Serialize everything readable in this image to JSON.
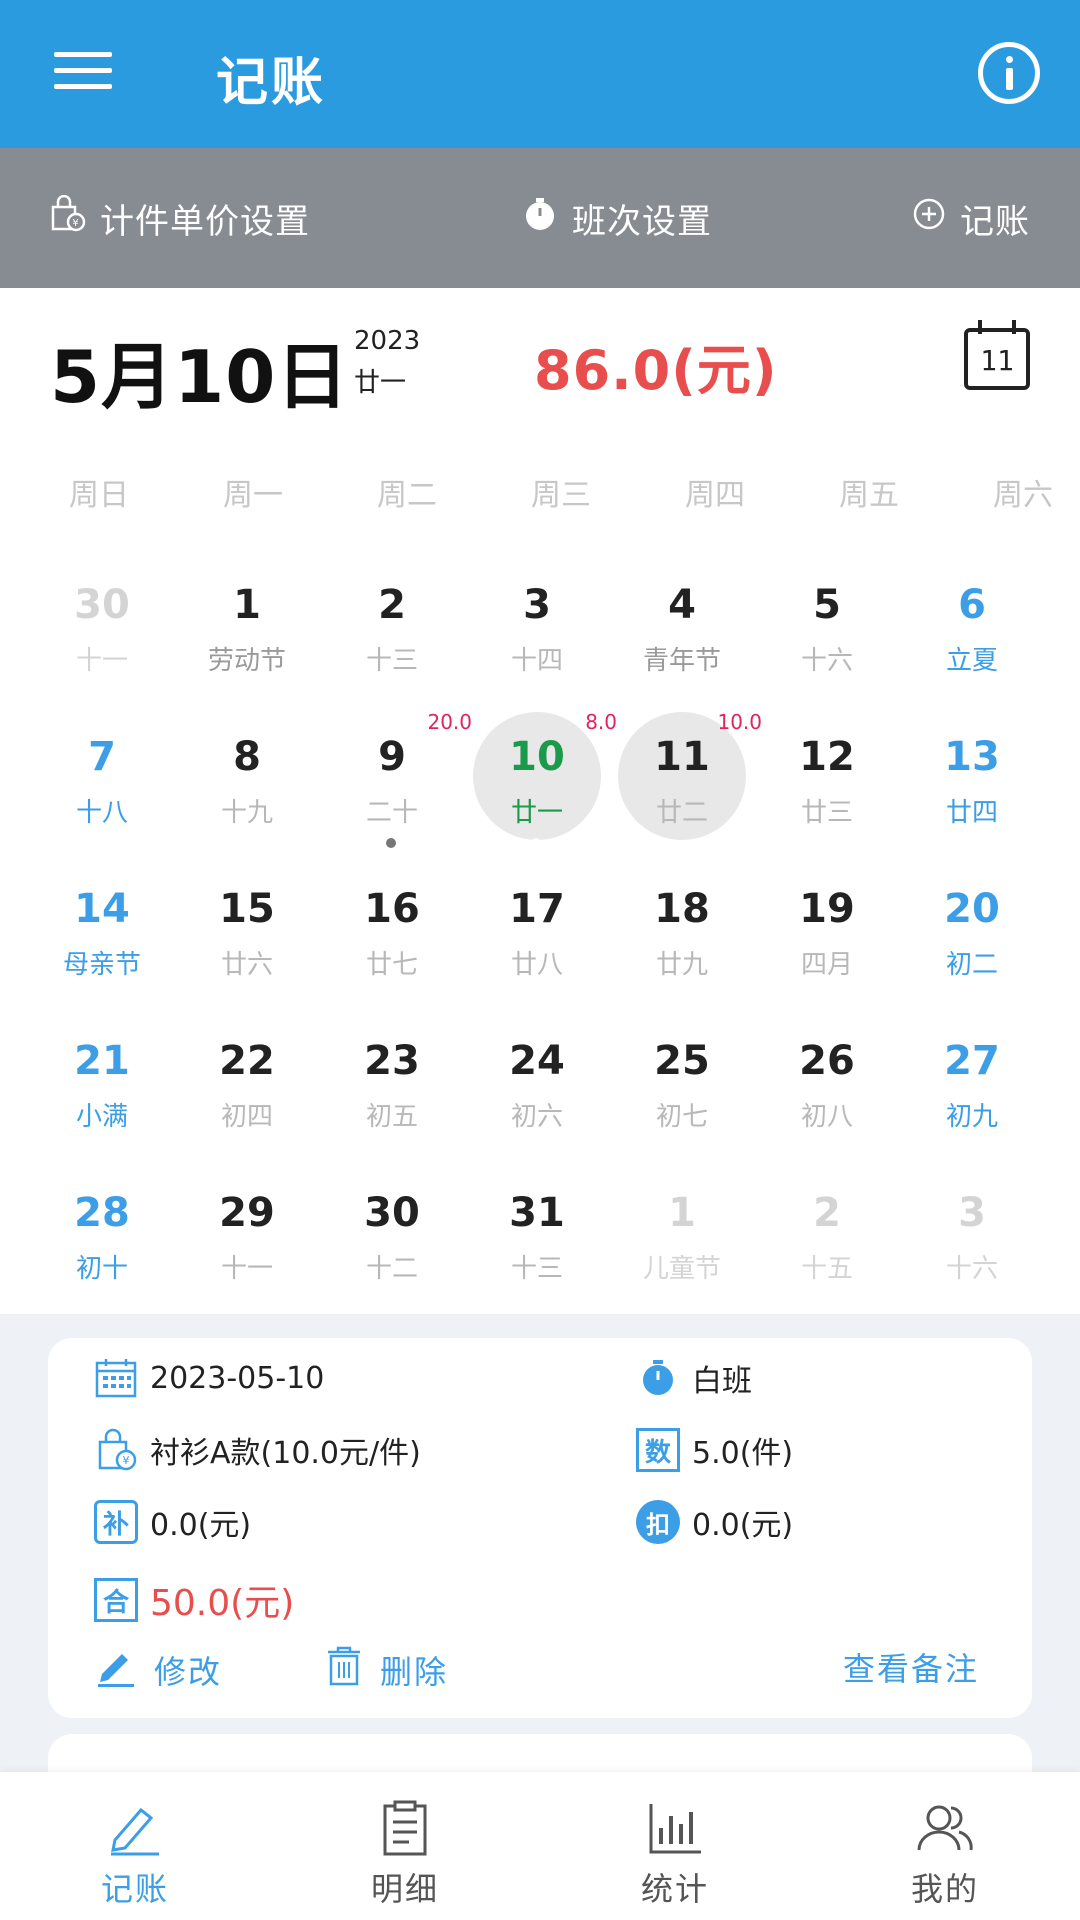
{
  "app": {
    "title": "记账"
  },
  "toolbar": {
    "price_setting": "计件单价设置",
    "shift_setting": "班次设置",
    "add_record": "记账"
  },
  "header": {
    "date": "5月10日",
    "year": "2023",
    "lunar": "廿一",
    "day_total": "86.0(元)",
    "calendar_icon_day": "11"
  },
  "weekdays": [
    "周日",
    "周一",
    "周二",
    "周三",
    "周四",
    "周五",
    "周六"
  ],
  "calendar": {
    "weeks": [
      [
        {
          "num": "30",
          "lunar": "十一",
          "type": "other"
        },
        {
          "num": "1",
          "lunar": "劳动节",
          "type": "holiday"
        },
        {
          "num": "2",
          "lunar": "十三",
          "type": ""
        },
        {
          "num": "3",
          "lunar": "十四",
          "type": ""
        },
        {
          "num": "4",
          "lunar": "青年节",
          "type": "holiday"
        },
        {
          "num": "5",
          "lunar": "十六",
          "type": ""
        },
        {
          "num": "6",
          "lunar": "立夏",
          "type": "weekend"
        }
      ],
      [
        {
          "num": "7",
          "lunar": "十八",
          "type": "weekend"
        },
        {
          "num": "8",
          "lunar": "十九",
          "type": ""
        },
        {
          "num": "9",
          "lunar": "二十",
          "type": "",
          "amount": "20.0",
          "mark": true
        },
        {
          "num": "10",
          "lunar": "廿一",
          "type": "today",
          "amount": "8.0",
          "mark": true,
          "selected": true
        },
        {
          "num": "11",
          "lunar": "廿二",
          "type": "",
          "amount": "10.0",
          "selected": true
        },
        {
          "num": "12",
          "lunar": "廿三",
          "type": ""
        },
        {
          "num": "13",
          "lunar": "廿四",
          "type": "weekend"
        }
      ],
      [
        {
          "num": "14",
          "lunar": "母亲节",
          "type": "weekend"
        },
        {
          "num": "15",
          "lunar": "廿六",
          "type": ""
        },
        {
          "num": "16",
          "lunar": "廿七",
          "type": ""
        },
        {
          "num": "17",
          "lunar": "廿八",
          "type": ""
        },
        {
          "num": "18",
          "lunar": "廿九",
          "type": ""
        },
        {
          "num": "19",
          "lunar": "四月",
          "type": ""
        },
        {
          "num": "20",
          "lunar": "初二",
          "type": "weekend"
        }
      ],
      [
        {
          "num": "21",
          "lunar": "小满",
          "type": "weekend"
        },
        {
          "num": "22",
          "lunar": "初四",
          "type": ""
        },
        {
          "num": "23",
          "lunar": "初五",
          "type": ""
        },
        {
          "num": "24",
          "lunar": "初六",
          "type": ""
        },
        {
          "num": "25",
          "lunar": "初七",
          "type": ""
        },
        {
          "num": "26",
          "lunar": "初八",
          "type": ""
        },
        {
          "num": "27",
          "lunar": "初九",
          "type": "weekend"
        }
      ],
      [
        {
          "num": "28",
          "lunar": "初十",
          "type": "weekend"
        },
        {
          "num": "29",
          "lunar": "十一",
          "type": ""
        },
        {
          "num": "30",
          "lunar": "十二",
          "type": ""
        },
        {
          "num": "31",
          "lunar": "十三",
          "type": ""
        },
        {
          "num": "1",
          "lunar": "儿童节",
          "type": "other"
        },
        {
          "num": "2",
          "lunar": "十五",
          "type": "other"
        },
        {
          "num": "3",
          "lunar": "十六",
          "type": "other"
        }
      ]
    ]
  },
  "record": {
    "date": "2023-05-10",
    "shift": "白班",
    "product": "衬衫A款(10.0元/件)",
    "quantity": "5.0(件)",
    "supplement": "0.0(元)",
    "deduction": "0.0(元)",
    "total": "50.0(元)",
    "edit_label": "修改",
    "delete_label": "删除",
    "note_label": "查看备注",
    "qty_icon": "数",
    "supp_icon": "补",
    "deduct_icon": "扣",
    "total_icon": "合"
  },
  "nav": {
    "items": [
      "记账",
      "明细",
      "统计",
      "我的"
    ]
  },
  "colors": {
    "primary": "#2b9be0",
    "toolbar": "#878b92",
    "accent": "#3c9ee6",
    "money": "#e94e4e",
    "amount_badge": "#e0245e",
    "today": "#1b9a4b"
  }
}
